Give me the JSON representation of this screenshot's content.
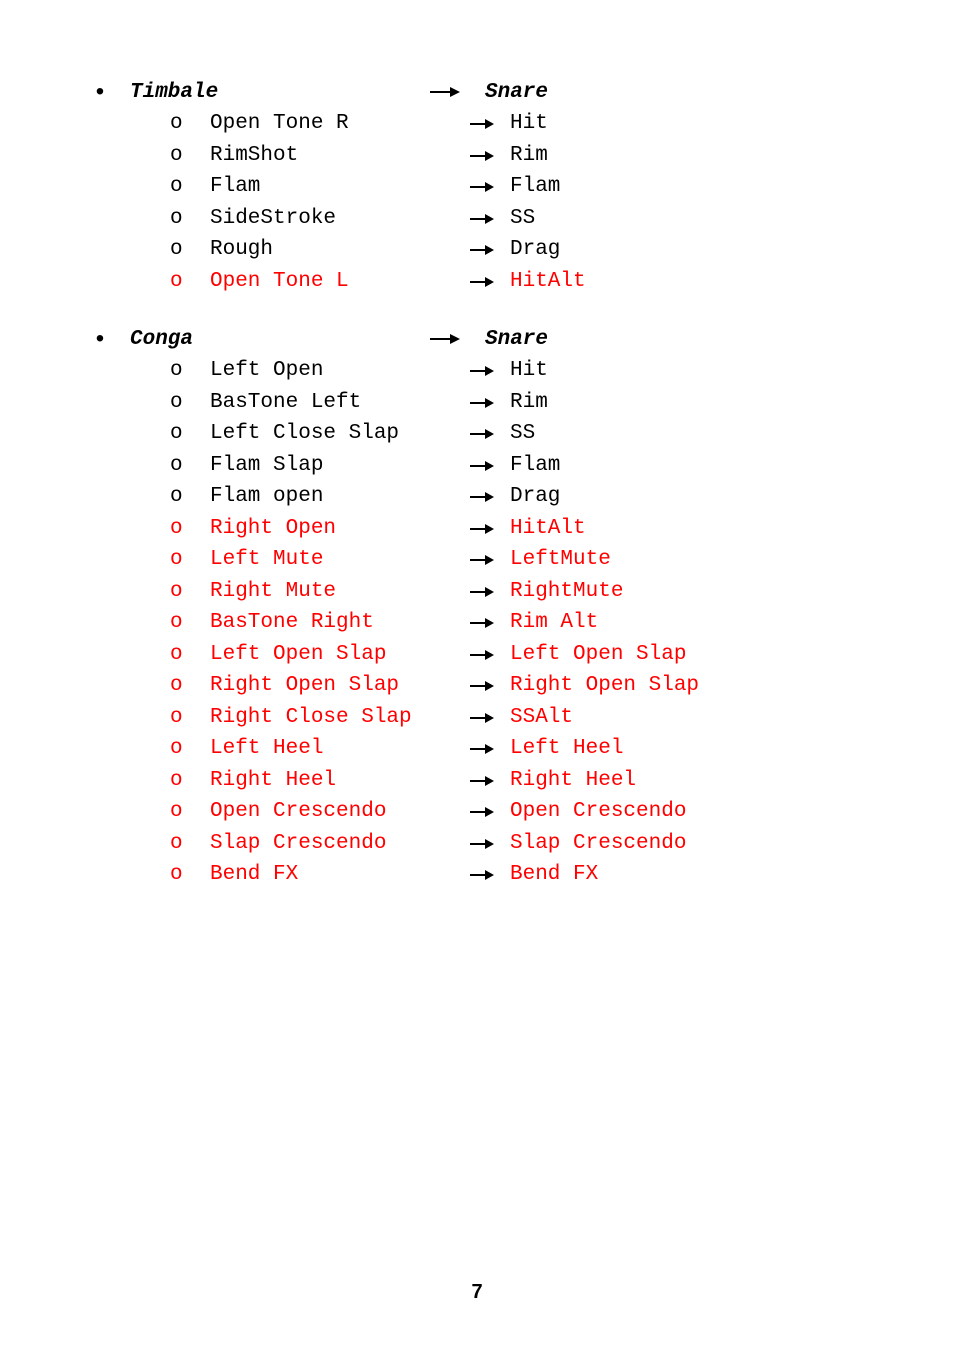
{
  "page_number": "7",
  "sections": [
    {
      "source_title": "Timbale",
      "target_title": "Snare",
      "rows": [
        {
          "src": "Open Tone R",
          "tgt": "Hit",
          "color": "black"
        },
        {
          "src": "RimShot",
          "tgt": "Rim",
          "color": "black"
        },
        {
          "src": "Flam",
          "tgt": "Flam",
          "color": "black"
        },
        {
          "src": "SideStroke",
          "tgt": "SS",
          "color": "black"
        },
        {
          "src": "Rough",
          "tgt": "Drag",
          "color": "black"
        },
        {
          "src": "Open Tone L",
          "tgt": "HitAlt",
          "color": "red"
        }
      ]
    },
    {
      "source_title": "Conga",
      "target_title": "Snare",
      "rows": [
        {
          "src": "Left Open",
          "tgt": "Hit",
          "color": "black"
        },
        {
          "src": "BasTone Left",
          "tgt": "Rim",
          "color": "black"
        },
        {
          "src": "Left Close Slap",
          "tgt": "SS",
          "color": "black"
        },
        {
          "src": "Flam Slap",
          "tgt": "Flam",
          "color": "black"
        },
        {
          "src": "Flam open",
          "tgt": "Drag",
          "color": "black"
        },
        {
          "src": "Right Open",
          "tgt": "HitAlt",
          "color": "red"
        },
        {
          "src": "Left Mute",
          "tgt": "LeftMute",
          "color": "red"
        },
        {
          "src": "Right Mute",
          "tgt": "RightMute",
          "color": "red"
        },
        {
          "src": "BasTone Right",
          "tgt": "Rim Alt",
          "color": "red"
        },
        {
          "src": "Left Open Slap",
          "tgt": "Left Open Slap",
          "color": "red"
        },
        {
          "src": "Right Open Slap",
          "tgt": "Right Open Slap",
          "color": "red"
        },
        {
          "src": "Right Close Slap",
          "tgt": "SSAlt",
          "color": "red"
        },
        {
          "src": "Left Heel",
          "tgt": "Left Heel",
          "color": "red"
        },
        {
          "src": "Right Heel",
          "tgt": "Right Heel",
          "color": "red"
        },
        {
          "src": "Open Crescendo",
          "tgt": "Open Crescendo",
          "color": "red"
        },
        {
          "src": "Slap Crescendo",
          "tgt": "Slap Crescendo",
          "color": "red"
        },
        {
          "src": "Bend FX",
          "tgt": "Bend FX",
          "color": "red"
        }
      ]
    }
  ]
}
